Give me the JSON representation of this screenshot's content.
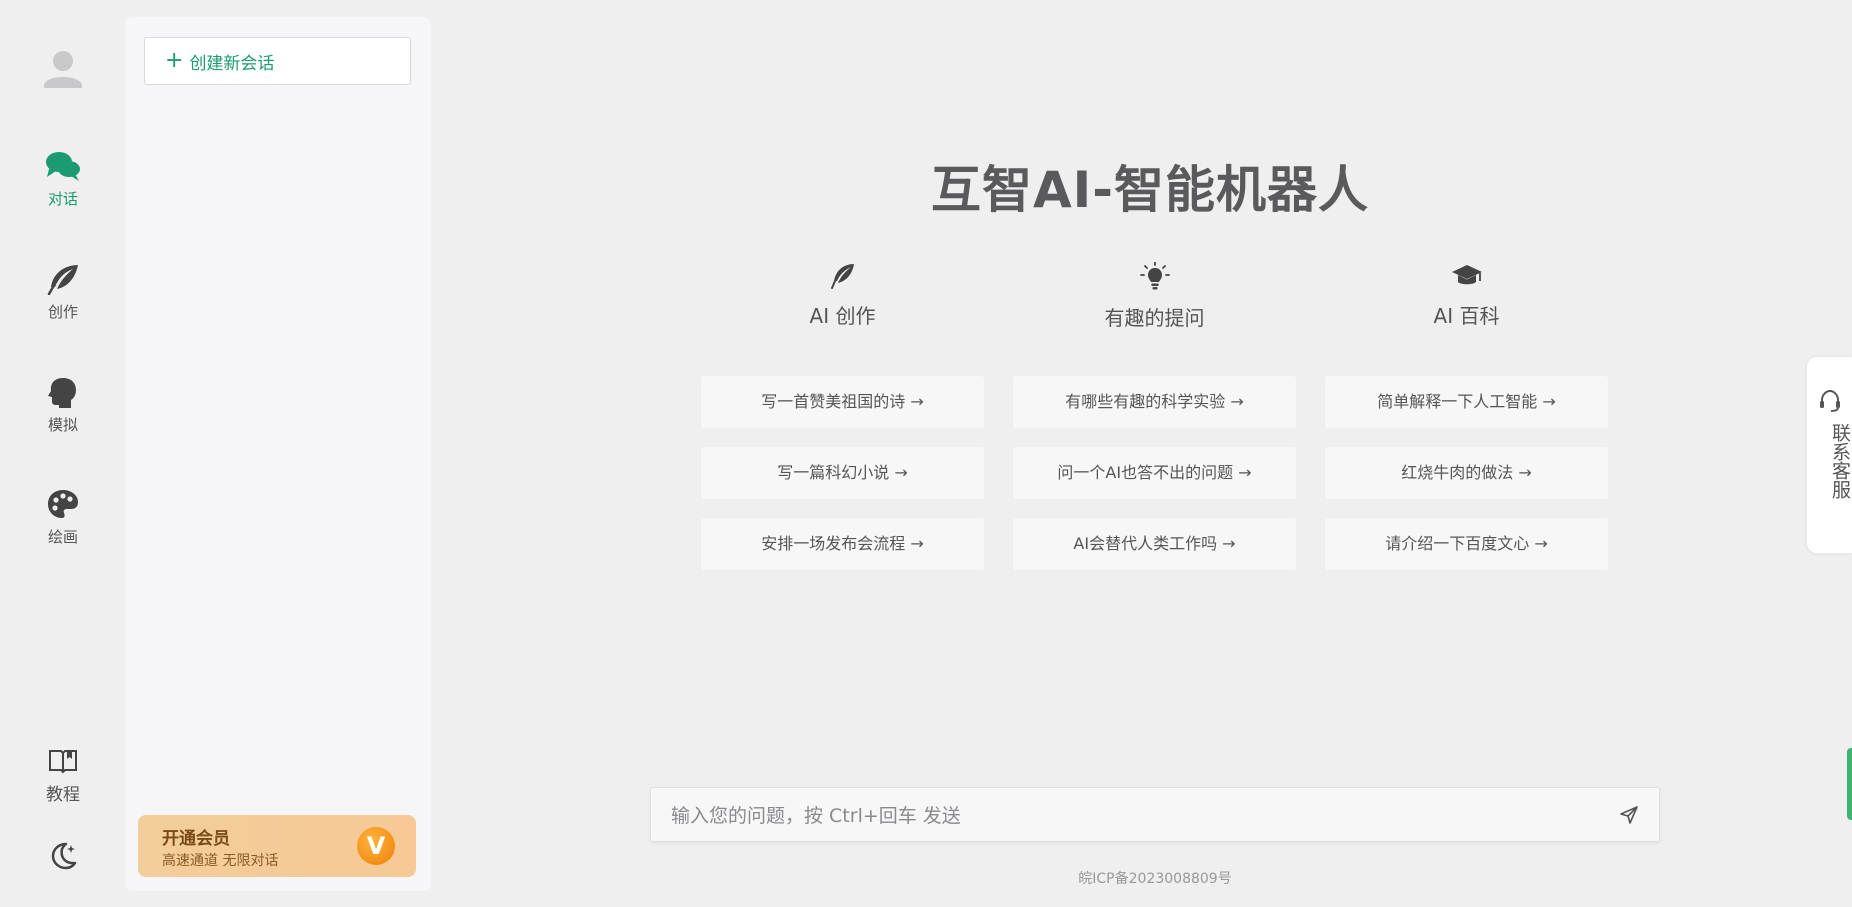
{
  "rail": {
    "items": [
      {
        "label": "对话",
        "icon": "chat-icon",
        "active": true
      },
      {
        "label": "创作",
        "icon": "feather-icon",
        "active": false
      },
      {
        "label": "模拟",
        "icon": "head-icon",
        "active": false
      },
      {
        "label": "绘画",
        "icon": "palette-icon",
        "active": false
      }
    ],
    "tutorial_label": "教程"
  },
  "panel": {
    "new_chat_label": "创建新会话",
    "vip_title": "开通会员",
    "vip_subtitle": "高速通道 无限对话",
    "vip_badge": "V"
  },
  "main": {
    "title": "互智AI-智能机器人",
    "columns": [
      {
        "title": "AI 创作",
        "icon": "feather-icon",
        "prompts": [
          "写一首赞美祖国的诗 →",
          "写一篇科幻小说 →",
          "安排一场发布会流程 →"
        ]
      },
      {
        "title": "有趣的提问",
        "icon": "lightbulb-icon",
        "prompts": [
          "有哪些有趣的科学实验 →",
          "问一个AI也答不出的问题 →",
          "AI会替代人类工作吗 →"
        ]
      },
      {
        "title": "AI 百科",
        "icon": "graduation-cap-icon",
        "prompts": [
          "简单解释一下人工智能 →",
          "红烧牛肉的做法 →",
          "请介绍一下百度文心 →"
        ]
      }
    ],
    "input_placeholder": "输入您的问题，按 Ctrl+回车 发送",
    "icp": "皖ICP备2023008809号"
  },
  "support": {
    "label": "联系客服"
  },
  "colors": {
    "accent": "#1c9a71",
    "vip_bg": "#f3cd9a",
    "vip_badge": "#f08a12"
  }
}
